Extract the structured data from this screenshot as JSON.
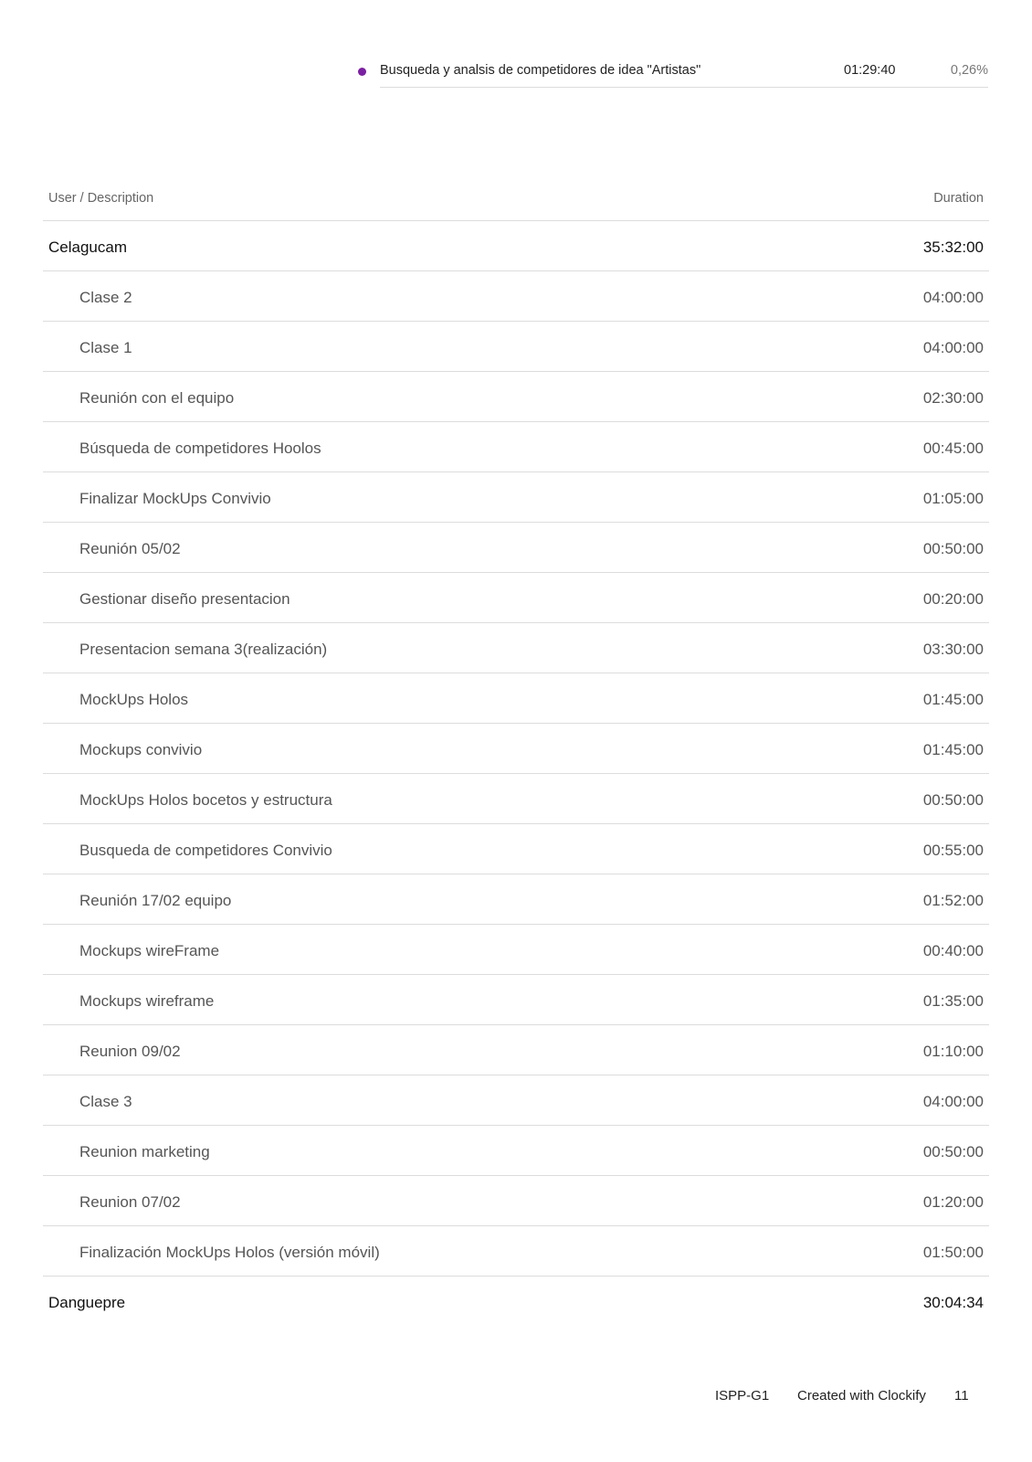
{
  "legend": {
    "color": "#7b1fa2",
    "label": "Busqueda y analsis de competidores de idea \"Artistas\"",
    "duration": "01:29:40",
    "percent": "0,26%"
  },
  "table": {
    "header": {
      "left": "User / Description",
      "right": "Duration"
    },
    "user1": {
      "name": "Celagucam",
      "duration": "35:32:00"
    },
    "entries": [
      {
        "description": "Clase 2",
        "duration": "04:00:00"
      },
      {
        "description": "Clase 1",
        "duration": "04:00:00"
      },
      {
        "description": "Reunión con el equipo",
        "duration": "02:30:00"
      },
      {
        "description": "Búsqueda de competidores Hoolos",
        "duration": "00:45:00"
      },
      {
        "description": "Finalizar MockUps Convivio",
        "duration": "01:05:00"
      },
      {
        "description": "Reunión 05/02",
        "duration": "00:50:00"
      },
      {
        "description": "Gestionar diseño presentacion",
        "duration": "00:20:00"
      },
      {
        "description": "Presentacion semana 3(realización)",
        "duration": "03:30:00"
      },
      {
        "description": "MockUps Holos",
        "duration": "01:45:00"
      },
      {
        "description": "Mockups convivio",
        "duration": "01:45:00"
      },
      {
        "description": "MockUps Holos bocetos y estructura",
        "duration": "00:50:00"
      },
      {
        "description": "Busqueda de competidores Convivio",
        "duration": "00:55:00"
      },
      {
        "description": "Reunión 17/02 equipo",
        "duration": "01:52:00"
      },
      {
        "description": "Mockups wireFrame",
        "duration": "00:40:00"
      },
      {
        "description": "Mockups wireframe",
        "duration": "01:35:00"
      },
      {
        "description": "Reunion 09/02",
        "duration": "01:10:00"
      },
      {
        "description": "Clase 3",
        "duration": "04:00:00"
      },
      {
        "description": "Reunion marketing",
        "duration": "00:50:00"
      },
      {
        "description": "Reunion 07/02",
        "duration": "01:20:00"
      },
      {
        "description": "Finalización MockUps Holos (versión móvil)",
        "duration": "01:50:00"
      }
    ],
    "user2": {
      "name": "Danguepre",
      "duration": "30:04:34"
    }
  },
  "footer": {
    "project": "ISPP-G1",
    "created": "Created with Clockify",
    "page": "11"
  }
}
